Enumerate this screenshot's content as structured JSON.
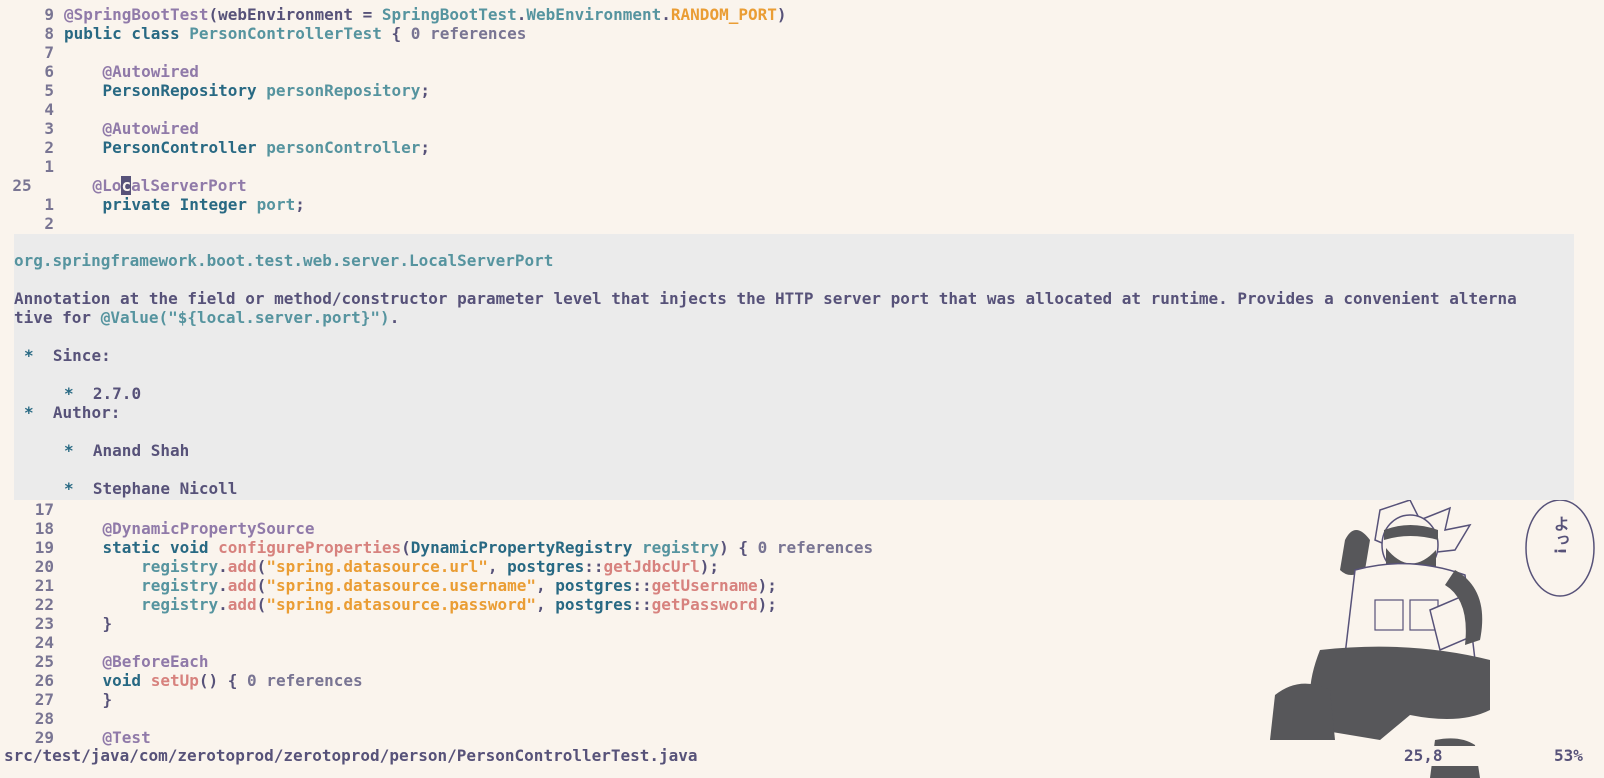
{
  "editor": {
    "top_lines": [
      {
        "num": "9",
        "tokens": [
          [
            "t-ann",
            "@SpringBootTest"
          ],
          [
            "t-plain",
            "("
          ],
          [
            "t-plain",
            "webEnvironment = "
          ],
          [
            "t-type",
            "SpringBootTest"
          ],
          [
            "t-plain",
            "."
          ],
          [
            "t-type",
            "WebEnvironment"
          ],
          [
            "t-plain",
            "."
          ],
          [
            "t-const",
            "RANDOM_PORT"
          ],
          [
            "t-plain",
            ")"
          ]
        ]
      },
      {
        "num": "8",
        "tokens": [
          [
            "t-kw",
            "public class "
          ],
          [
            "t-type",
            "PersonControllerTest"
          ],
          [
            "t-plain",
            " { "
          ],
          [
            "t-inlay",
            "0 references"
          ]
        ]
      },
      {
        "num": "7",
        "tokens": []
      },
      {
        "num": "6",
        "tokens": [
          [
            "t-plain",
            "    "
          ],
          [
            "t-ann",
            "@Autowired"
          ]
        ]
      },
      {
        "num": "5",
        "tokens": [
          [
            "t-plain",
            "    "
          ],
          [
            "t-type2",
            "PersonRepository"
          ],
          [
            "t-plain",
            " "
          ],
          [
            "t-type",
            "personRepository"
          ],
          [
            "t-plain",
            ";"
          ]
        ]
      },
      {
        "num": "4",
        "tokens": []
      },
      {
        "num": "3",
        "tokens": [
          [
            "t-plain",
            "    "
          ],
          [
            "t-ann",
            "@Autowired"
          ]
        ]
      },
      {
        "num": "2",
        "tokens": [
          [
            "t-plain",
            "    "
          ],
          [
            "t-type2",
            "PersonController"
          ],
          [
            "t-plain",
            " "
          ],
          [
            "t-type",
            "personController"
          ],
          [
            "t-plain",
            ";"
          ]
        ]
      },
      {
        "num": "1",
        "tokens": []
      },
      {
        "num": "25",
        "current": true,
        "tokens": [
          [
            "t-plain",
            "    "
          ],
          [
            "t-ann",
            "@Lo"
          ],
          [
            "cursor-char",
            "c"
          ],
          [
            "t-ann",
            "alServerPort"
          ]
        ]
      },
      {
        "num": "1",
        "tokens": [
          [
            "t-plain",
            "    "
          ],
          [
            "t-kw",
            "private "
          ],
          [
            "t-type2",
            "Integer"
          ],
          [
            "t-plain",
            " "
          ],
          [
            "t-type",
            "port"
          ],
          [
            "t-plain",
            ";"
          ]
        ]
      },
      {
        "num": "2",
        "tokens": []
      }
    ],
    "bottom_lines": [
      {
        "num": "17",
        "tokens": []
      },
      {
        "num": "18",
        "tokens": [
          [
            "t-plain",
            "    "
          ],
          [
            "t-ann",
            "@DynamicPropertySource"
          ]
        ]
      },
      {
        "num": "19",
        "tokens": [
          [
            "t-plain",
            "    "
          ],
          [
            "t-kw",
            "static void "
          ],
          [
            "t-fn",
            "configureProperties"
          ],
          [
            "t-plain",
            "("
          ],
          [
            "t-type2",
            "DynamicPropertyRegistry"
          ],
          [
            "t-plain",
            " "
          ],
          [
            "t-type",
            "registry"
          ],
          [
            "t-plain",
            ") { "
          ],
          [
            "t-inlay",
            "0 references"
          ]
        ]
      },
      {
        "num": "20",
        "tokens": [
          [
            "t-plain",
            "        "
          ],
          [
            "t-type",
            "registry"
          ],
          [
            "t-plain",
            "."
          ],
          [
            "t-fn",
            "add"
          ],
          [
            "t-plain",
            "("
          ],
          [
            "t-str",
            "\"spring.datasource.url\""
          ],
          [
            "t-plain",
            ", "
          ],
          [
            "t-type2",
            "postgres"
          ],
          [
            "t-plain",
            "::"
          ],
          [
            "t-fn",
            "getJdbcUrl"
          ],
          [
            "t-plain",
            ");"
          ]
        ]
      },
      {
        "num": "21",
        "tokens": [
          [
            "t-plain",
            "        "
          ],
          [
            "t-type",
            "registry"
          ],
          [
            "t-plain",
            "."
          ],
          [
            "t-fn",
            "add"
          ],
          [
            "t-plain",
            "("
          ],
          [
            "t-str",
            "\"spring.datasource.username\""
          ],
          [
            "t-plain",
            ", "
          ],
          [
            "t-type2",
            "postgres"
          ],
          [
            "t-plain",
            "::"
          ],
          [
            "t-fn",
            "getUsername"
          ],
          [
            "t-plain",
            ");"
          ]
        ]
      },
      {
        "num": "22",
        "tokens": [
          [
            "t-plain",
            "        "
          ],
          [
            "t-type",
            "registry"
          ],
          [
            "t-plain",
            "."
          ],
          [
            "t-fn",
            "add"
          ],
          [
            "t-plain",
            "("
          ],
          [
            "t-str",
            "\"spring.datasource.password\""
          ],
          [
            "t-plain",
            ", "
          ],
          [
            "t-type2",
            "postgres"
          ],
          [
            "t-plain",
            "::"
          ],
          [
            "t-fn",
            "getPassword"
          ],
          [
            "t-plain",
            ");"
          ]
        ]
      },
      {
        "num": "23",
        "tokens": [
          [
            "t-plain",
            "    }"
          ]
        ]
      },
      {
        "num": "24",
        "tokens": []
      },
      {
        "num": "25",
        "tokens": [
          [
            "t-plain",
            "    "
          ],
          [
            "t-ann",
            "@BeforeEach"
          ]
        ]
      },
      {
        "num": "26",
        "tokens": [
          [
            "t-plain",
            "    "
          ],
          [
            "t-kw",
            "void "
          ],
          [
            "t-fn",
            "setUp"
          ],
          [
            "t-plain",
            "() { "
          ],
          [
            "t-inlay",
            "0 references"
          ]
        ]
      },
      {
        "num": "27",
        "tokens": [
          [
            "t-plain",
            "    }"
          ]
        ]
      },
      {
        "num": "28",
        "tokens": []
      },
      {
        "num": "29",
        "tokens": [
          [
            "t-plain",
            "    "
          ],
          [
            "t-ann",
            "@Test"
          ]
        ]
      }
    ]
  },
  "hover": {
    "fqn": "org.springframework.boot.test.web.server.LocalServerPort",
    "desc_line1": "Annotation at the field or method/constructor parameter level that injects the HTTP server port that was allocated at runtime. Provides a convenient alterna",
    "desc_line2_prefix": "tive for ",
    "desc_line2_code": "@Value(\"${local.server.port}\")",
    "desc_line2_suffix": ".",
    "bullet": "*",
    "since_label": "Since:",
    "since_value": "2.7.0",
    "author_label": "Author:",
    "authors": [
      "Anand Shah",
      "Stephane Nicoll"
    ]
  },
  "status": {
    "file": "src/test/java/com/zerotoprod/zerotoprod/person/PersonControllerTest.java",
    "position": "25,8",
    "percent": "53%"
  },
  "wallpaper": {
    "speech_text": "よっ!",
    "icon": "manga-character-illustration"
  },
  "colors": {
    "background": "#faf4ed",
    "popup_background": "#ebebeb",
    "text": "#575279",
    "annotation": "#907aa9",
    "keyword": "#286983",
    "type": "#56949f",
    "function": "#d7827e",
    "string": "#ea9d34"
  }
}
